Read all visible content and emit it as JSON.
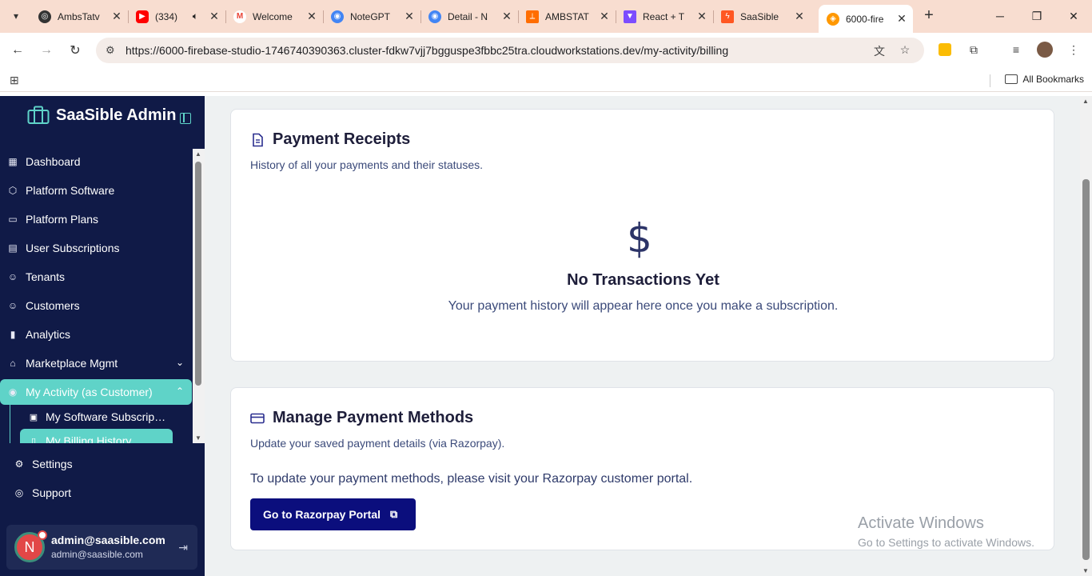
{
  "browser": {
    "tabs": [
      {
        "title": "AmbsTatv",
        "color": "#333333",
        "icon": "openai-icon"
      },
      {
        "title": "(334)",
        "color": "#ff0000",
        "icon": "youtube-icon"
      },
      {
        "title": "Welcome",
        "color": "#ea4335",
        "icon": "gmail-icon"
      },
      {
        "title": "NoteGPT",
        "color": "#4285f4",
        "icon": "notegpt-icon"
      },
      {
        "title": "Detail - N",
        "color": "#4285f4",
        "icon": "page-icon"
      },
      {
        "title": "AMBSTAT",
        "color": "#ff6d00",
        "icon": "ambstat-icon"
      },
      {
        "title": "React + T",
        "color": "#7c4dff",
        "icon": "vite-icon"
      },
      {
        "title": "SaaSible",
        "color": "#ff5722",
        "icon": "firebase-icon"
      },
      {
        "title": "6000-fire",
        "color": "#ff9800",
        "icon": "firebase-studio-icon"
      }
    ],
    "url_prefix": "https://",
    "url_host": "6000-firebase-studio-1746740390363.cluster-fdkw7vjj7bgguspe3fbbc25tra.cloudworkstations.dev",
    "url_path": "/my-activity/billing",
    "bookmarks_label": "All Bookmarks"
  },
  "sidebar": {
    "brand": "SaaSible Admin",
    "items": [
      {
        "label": "Dashboard",
        "icon": "grid-icon"
      },
      {
        "label": "Platform Software",
        "icon": "box-icon"
      },
      {
        "label": "Platform Plans",
        "icon": "card-icon"
      },
      {
        "label": "User Subscriptions",
        "icon": "subscriptions-icon"
      },
      {
        "label": "Tenants",
        "icon": "user-icon"
      },
      {
        "label": "Customers",
        "icon": "user-icon"
      },
      {
        "label": "Analytics",
        "icon": "bar-chart-icon"
      },
      {
        "label": "Marketplace Mgmt",
        "icon": "store-icon"
      },
      {
        "label": "My Activity (as Customer)",
        "icon": "user-circle-icon"
      }
    ],
    "subitems": [
      {
        "label": "My Software Subscrip…",
        "icon": "bag-icon"
      },
      {
        "label": "My Billing History",
        "icon": "file-icon"
      }
    ],
    "footer": [
      {
        "label": "Settings",
        "icon": "gear-icon"
      },
      {
        "label": "Support",
        "icon": "lifebuoy-icon"
      }
    ],
    "user": {
      "initial": "N",
      "name": "admin@saasible.com",
      "email": "admin@saasible.com"
    }
  },
  "main": {
    "receipts": {
      "title": "Payment Receipts",
      "subtitle": "History of all your payments and their statuses.",
      "empty_icon": "$",
      "empty_title": "No Transactions Yet",
      "empty_desc": "Your payment history will appear here once you make a subscription."
    },
    "methods": {
      "title": "Manage Payment Methods",
      "subtitle": "Update your saved payment details (via Razorpay).",
      "instruction": "To update your payment methods, please visit your Razorpay customer portal.",
      "button": "Go to Razorpay Portal"
    }
  },
  "watermark": {
    "line1": "Activate Windows",
    "line2": "Go to Settings to activate Windows."
  }
}
